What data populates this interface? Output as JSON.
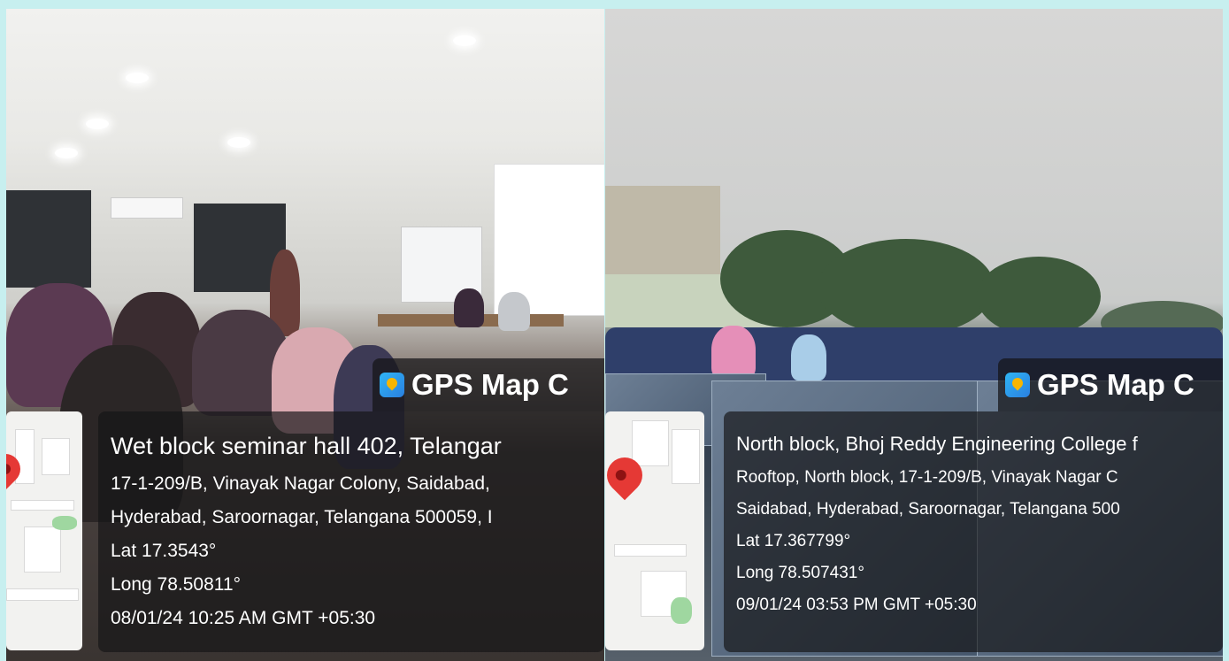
{
  "left": {
    "app_label": "GPS Map C",
    "title": "Wet block seminar hall 402, Telangar",
    "address_line1": "17-1-209/B, Vinayak Nagar Colony, Saidabad,",
    "address_line2": "Hyderabad, Saroornagar, Telangana 500059, I",
    "lat": "Lat 17.3543°",
    "long": "Long 78.50811°",
    "datetime": "08/01/24 10:25 AM GMT +05:30"
  },
  "right": {
    "app_label": "GPS Map C",
    "title": "North block, Bhoj Reddy Engineering College f",
    "address_line1": "Rooftop, North block, 17-1-209/B, Vinayak Nagar C",
    "address_line2": "Saidabad, Hyderabad, Saroornagar, Telangana 500",
    "lat": "Lat 17.367799°",
    "long": "Long 78.507431°",
    "datetime": "09/01/24 03:53 PM GMT +05:30"
  },
  "colors": {
    "frame": "#c7efef",
    "overlay": "#141416",
    "pin": "#e53935",
    "app_icon": "#2a7fe0"
  },
  "icons": [
    "gps-map-camera-icon",
    "map-pin-icon"
  ]
}
